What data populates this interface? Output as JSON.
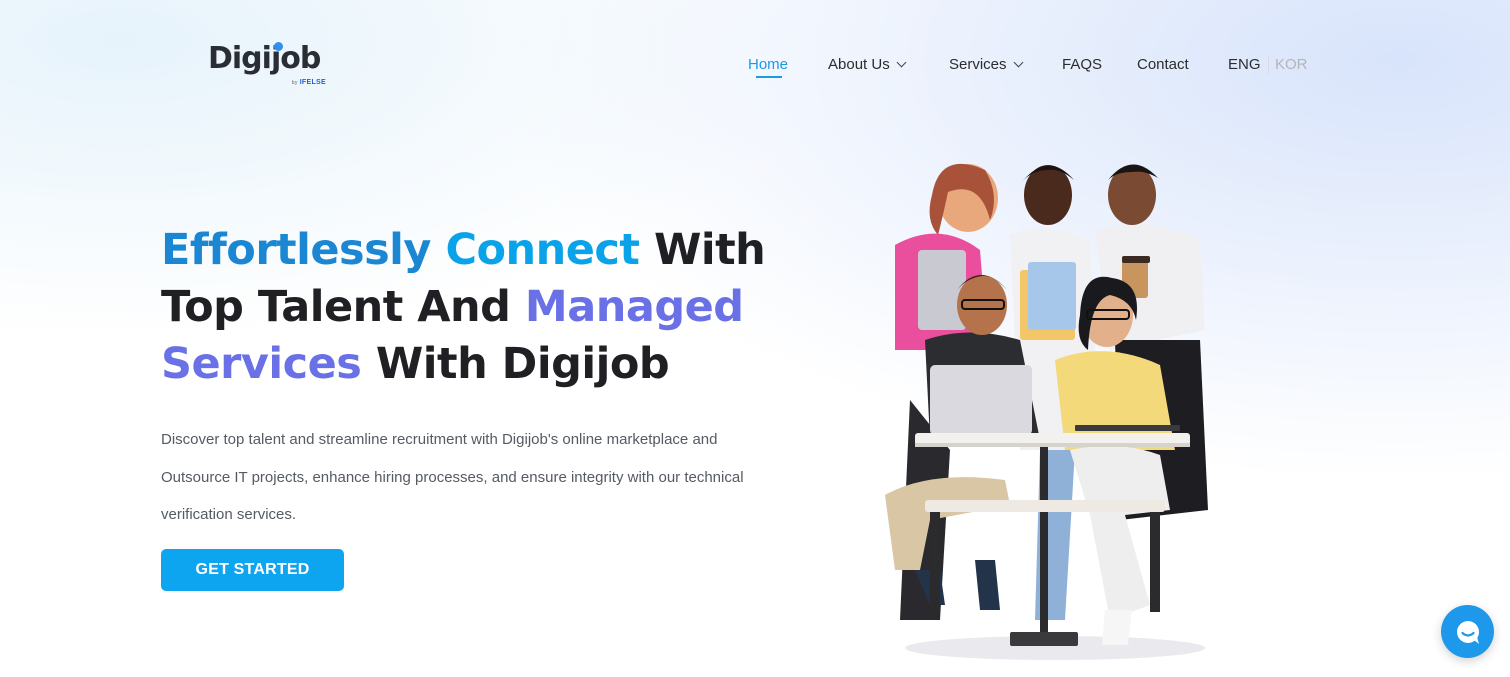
{
  "logo": {
    "text": "Digijob",
    "sub_prefix": "by",
    "sub_brand": "IFELSE"
  },
  "nav": {
    "home": "Home",
    "about": "About Us",
    "services": "Services",
    "faqs": "FAQS",
    "contact": "Contact",
    "lang_eng": "ENG",
    "lang_kor": "KOR"
  },
  "hero": {
    "headline": {
      "part1": "Effortlessly",
      "part2": "Connect",
      "part3": "With Top Talent And",
      "part4": "Managed",
      "part5": "Services",
      "part6": "With Digijob"
    },
    "description": "Discover top talent and streamline recruitment with Digijob's online marketplace and Outsource IT projects, enhance hiring processes, and ensure integrity with our technical verification services.",
    "cta_label": "GET STARTED"
  },
  "illustration": {
    "icon": "team-people-illustration"
  },
  "chat": {
    "icon": "chat-bubble-icon"
  },
  "colors": {
    "accent_blue": "#0ea5f0",
    "headline_blue": "#1b86d2",
    "headline_purple": "#6a70e6",
    "nav_active": "#1a9be6"
  }
}
